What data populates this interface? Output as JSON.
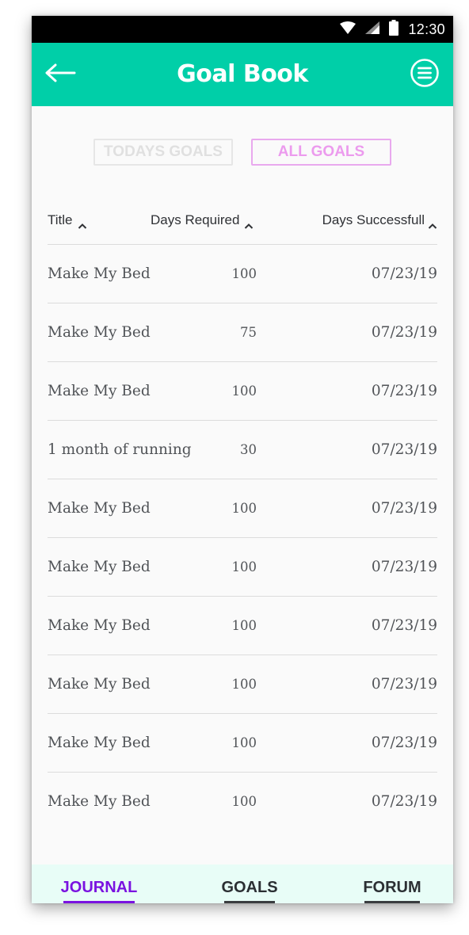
{
  "status_bar": {
    "time": "12:30",
    "icons": [
      "wifi-icon",
      "signal-icon",
      "battery-icon"
    ]
  },
  "app_bar": {
    "title": "Goal Book",
    "left_icon": "back-arrow-icon",
    "right_icon": "menu-icon"
  },
  "filters": {
    "today_label": "TODAYS GOALS",
    "all_label": "ALL GOALS",
    "active": "all"
  },
  "table": {
    "columns": [
      "Title",
      "Days Required",
      "Days Successfull"
    ],
    "rows": [
      {
        "title": "Make My Bed",
        "required": "100",
        "success": "07/23/19"
      },
      {
        "title": "Make My Bed",
        "required": "75",
        "success": "07/23/19"
      },
      {
        "title": "Make My Bed",
        "required": "100",
        "success": "07/23/19"
      },
      {
        "title": "1 month of running",
        "required": "30",
        "success": "07/23/19"
      },
      {
        "title": "Make My Bed",
        "required": "100",
        "success": "07/23/19"
      },
      {
        "title": "Make My Bed",
        "required": "100",
        "success": "07/23/19"
      },
      {
        "title": "Make My Bed",
        "required": "100",
        "success": "07/23/19"
      },
      {
        "title": "Make My Bed",
        "required": "100",
        "success": "07/23/19"
      },
      {
        "title": "Make My Bed",
        "required": "100",
        "success": "07/23/19"
      },
      {
        "title": "Make My Bed",
        "required": "100",
        "success": "07/23/19"
      }
    ]
  },
  "bottom_nav": {
    "tabs": [
      {
        "label": "JOURNAL",
        "active": true
      },
      {
        "label": "GOALS",
        "active": false
      },
      {
        "label": "FORUM",
        "active": false
      }
    ]
  },
  "colors": {
    "app_bar": "#00cfa8",
    "active_filter": "#ec9bee",
    "active_tab": "#7a12e0",
    "bottom_nav_bg": "#e8fdf7"
  }
}
